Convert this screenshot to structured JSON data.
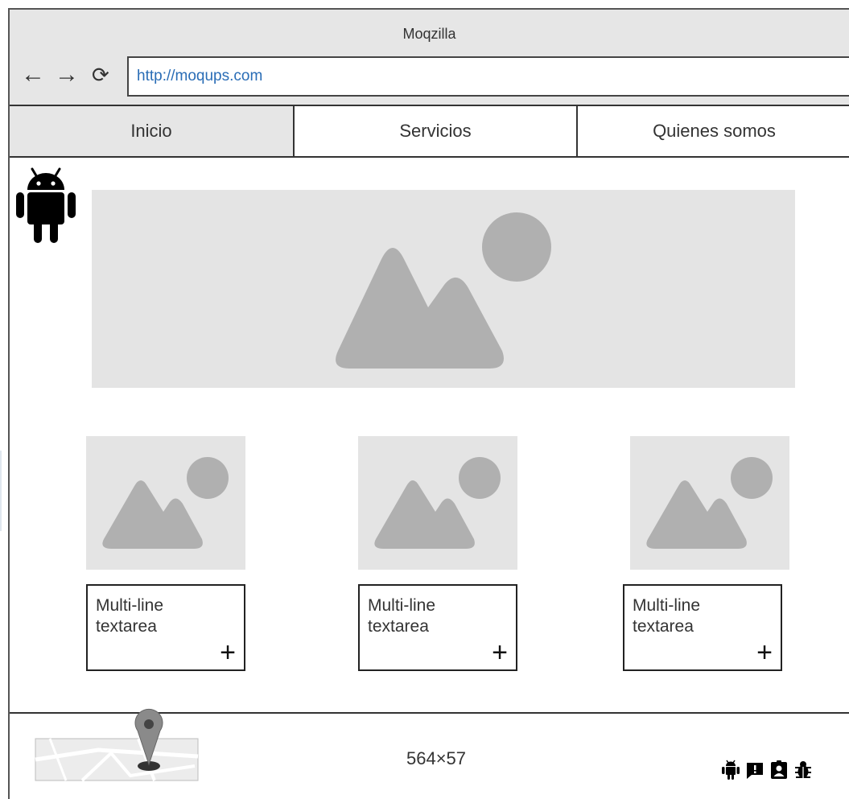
{
  "window": {
    "title": "Moqzilla"
  },
  "toolbar": {
    "back_label": "←",
    "forward_label": "→",
    "reload_label": "⟳"
  },
  "address_bar": {
    "value": "http://moqups.com"
  },
  "tabs": [
    {
      "label": "Inicio",
      "active": true
    },
    {
      "label": "Servicios",
      "active": false
    },
    {
      "label": "Quienes somos",
      "active": false
    }
  ],
  "cards": [
    {
      "textarea": "Multi-line\ntextarea",
      "add_label": "+"
    },
    {
      "textarea": "Multi-line\ntextarea",
      "add_label": "+"
    },
    {
      "textarea": "Multi-line\ntextarea",
      "add_label": "+"
    }
  ],
  "footer": {
    "dimensions": "564×57"
  },
  "icons": {
    "logo": "android-icon",
    "map": "map-icon",
    "pin": "map-pin-icon",
    "footer_icons": [
      "android-icon",
      "feedback-icon",
      "contact-icon",
      "bug-icon"
    ]
  },
  "colors": {
    "placeholder_bg": "#e4e4e4",
    "placeholder_shape": "#b0b0b0",
    "url_text": "#2a6db6",
    "chrome_bg": "#e6e6e6"
  }
}
